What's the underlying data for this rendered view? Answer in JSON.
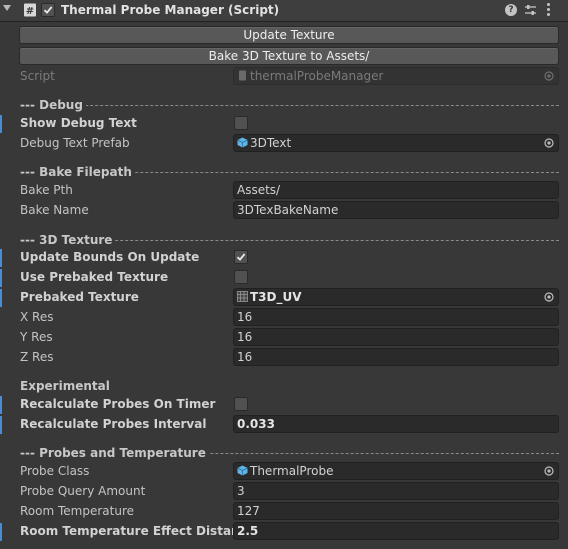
{
  "header": {
    "title": "Thermal Probe Manager (Script)",
    "enabled": true,
    "help_icon": "help-icon",
    "presets_icon": "presets-icon",
    "menu_icon": "kebab-menu-icon"
  },
  "buttons": {
    "update_texture": "Update Texture",
    "bake_texture": "Bake 3D Texture to Assets/"
  },
  "script": {
    "label": "Script",
    "value": "thermalProbeManager"
  },
  "debug": {
    "section": "--- Debug",
    "show_debug_text_label": "Show Debug Text",
    "show_debug_text": false,
    "debug_text_prefab_label": "Debug Text Prefab",
    "debug_text_prefab_value": "3DText"
  },
  "bake_filepath": {
    "section": "--- Bake Filepath",
    "bake_pth_label": "Bake Pth",
    "bake_pth_value": "Assets/",
    "bake_name_label": "Bake Name",
    "bake_name_value": "3DTexBakeName"
  },
  "texture3d": {
    "section": "--- 3D Texture",
    "update_bounds_label": "Update Bounds On Update",
    "update_bounds": true,
    "use_prebaked_label": "Use Prebaked Texture",
    "use_prebaked": false,
    "prebaked_label": "Prebaked Texture",
    "prebaked_value": "T3D_UV",
    "x_res_label": "X Res",
    "x_res_value": "16",
    "y_res_label": "Y Res",
    "y_res_value": "16",
    "z_res_label": "Z Res",
    "z_res_value": "16"
  },
  "experimental": {
    "title": "Experimental",
    "recalc_timer_label": "Recalculate Probes On Timer",
    "recalc_timer": false,
    "recalc_interval_label": "Recalculate Probes Interval",
    "recalc_interval_value": "0.033"
  },
  "probes": {
    "section": "--- Probes and Temperature",
    "probe_class_label": "Probe Class",
    "probe_class_value": "ThermalProbe",
    "query_amount_label": "Probe Query Amount",
    "query_amount_value": "3",
    "room_temp_label": "Room Temperature",
    "room_temp_value": "127",
    "effect_distance_label": "Room Temperature Effect Distance",
    "effect_distance_value": "2.5"
  },
  "colors": {
    "background": "#383838",
    "field": "#2a2a2a",
    "button": "#585858",
    "override_marker": "#4a8cd6",
    "prefab_icon": "#5fb3e8"
  }
}
